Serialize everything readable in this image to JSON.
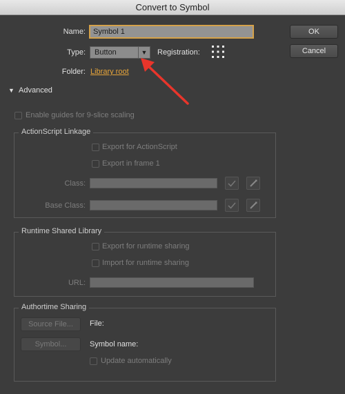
{
  "window": {
    "title": "Convert to Symbol"
  },
  "form": {
    "name_label": "Name:",
    "name_value": "Symbol 1",
    "type_label": "Type:",
    "type_value": "Button",
    "registration_label": "Registration:",
    "folder_label": "Folder:",
    "folder_value": "Library root"
  },
  "buttons": {
    "ok": "OK",
    "cancel": "Cancel"
  },
  "advanced": {
    "toggle_label": "Advanced",
    "nine_slice_label": "Enable guides for 9-slice scaling"
  },
  "linkage": {
    "title": "ActionScript Linkage",
    "export_as": "Export for ActionScript",
    "export_frame1": "Export in frame 1",
    "class_label": "Class:",
    "base_class_label": "Base Class:"
  },
  "rsl": {
    "title": "Runtime Shared Library",
    "export_runtime": "Export for runtime sharing",
    "import_runtime": "Import for runtime sharing",
    "url_label": "URL:"
  },
  "authortime": {
    "title": "Authortime Sharing",
    "source_file_button": "Source File...",
    "file_label": "File:",
    "symbol_button": "Symbol...",
    "symbol_name_label": "Symbol name:",
    "update_auto": "Update automatically"
  },
  "colors": {
    "accent": "#e7a53a",
    "arrow": "#e8352b",
    "background": "#3c3c3c"
  }
}
